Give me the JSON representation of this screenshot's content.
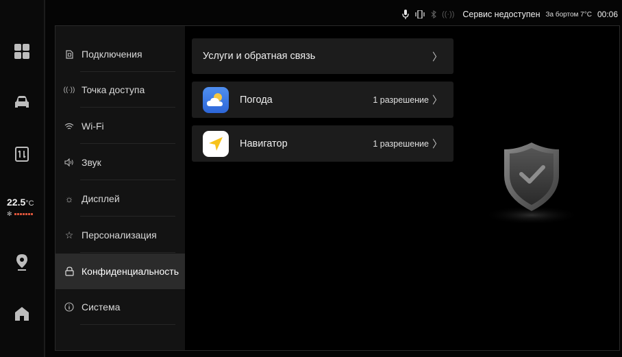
{
  "dock": {
    "temperature": "22.5",
    "temperature_unit": "°C",
    "fan_level": 7,
    "items": [
      {
        "name": "apps-grid-icon"
      },
      {
        "name": "car-icon"
      },
      {
        "name": "window-switch-icon"
      },
      {
        "name": "location-pin-icon"
      },
      {
        "name": "home-icon"
      }
    ]
  },
  "status_bar": {
    "service": "Сервис недоступен",
    "outside_temp": "За бортом 7°C",
    "time": "00:06"
  },
  "menu": {
    "items": [
      {
        "label": "Подключения"
      },
      {
        "label": "Точка доступа"
      },
      {
        "label": "Wi-Fi"
      },
      {
        "label": "Звук"
      },
      {
        "label": "Дисплей"
      },
      {
        "label": "Персонализация"
      },
      {
        "label": "Конфиденциальность"
      },
      {
        "label": "Система"
      }
    ],
    "active_index": 6
  },
  "content": {
    "services_label": "Услуги и обратная связь",
    "apps": [
      {
        "name": "Погода",
        "permissions": "1 разрешение",
        "icon": "weather-app-icon"
      },
      {
        "name": "Навигатор",
        "permissions": "1 разрешение",
        "icon": "navigator-app-icon"
      }
    ]
  },
  "colors": {
    "background": "#000000",
    "menu_bg": "#131313",
    "menu_active_bg": "#2b2b2b",
    "card_bg": "#1c1c1c",
    "weather_icon": "#3a7be8",
    "navigator_icon": "#f7c21b"
  }
}
